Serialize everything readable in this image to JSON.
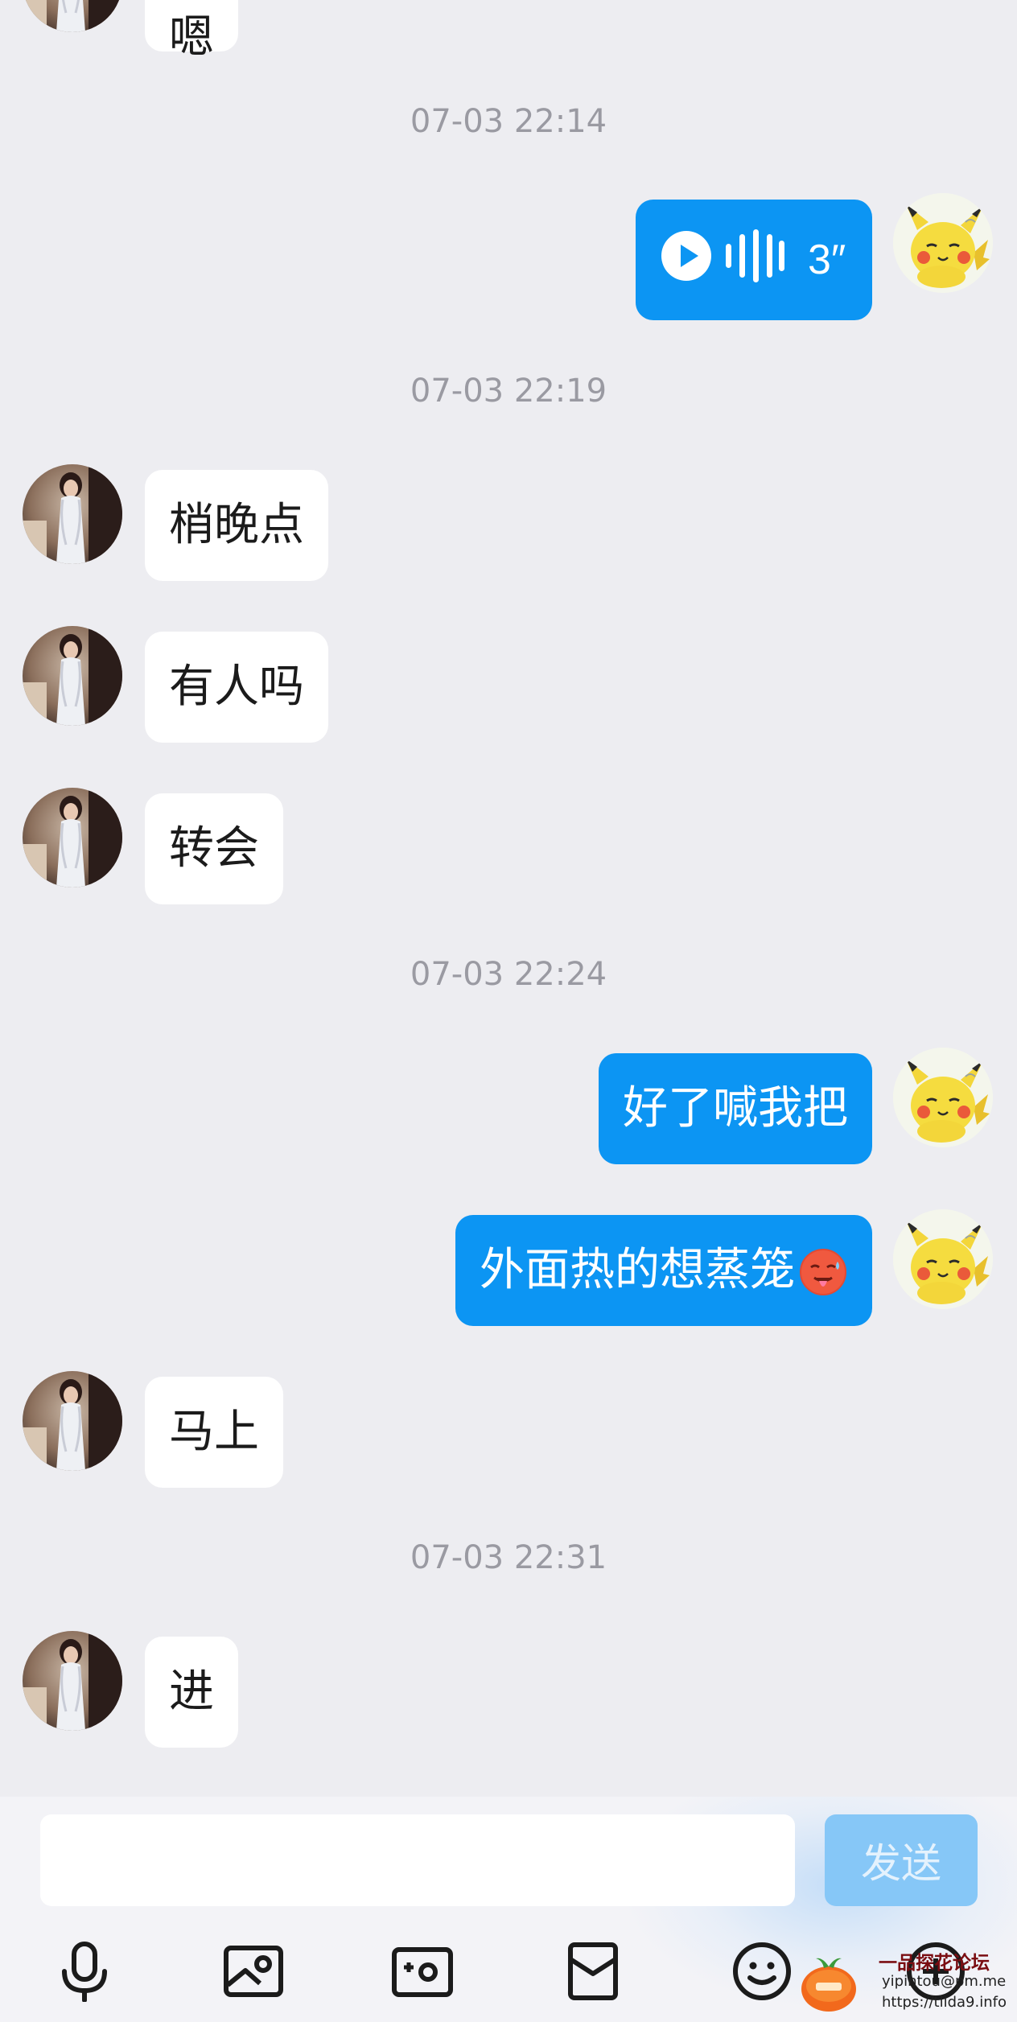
{
  "messages": [
    {
      "type": "timestamp",
      "text": "07-03 22:14"
    },
    {
      "type": "voice",
      "side": "out",
      "duration": "3″"
    },
    {
      "type": "timestamp",
      "text": "07-03 22:19"
    },
    {
      "type": "text",
      "side": "in",
      "text": "梢晚点"
    },
    {
      "type": "text",
      "side": "in",
      "text": "有人吗"
    },
    {
      "type": "text",
      "side": "in",
      "text": "转会"
    },
    {
      "type": "timestamp",
      "text": "07-03 22:24"
    },
    {
      "type": "text",
      "side": "out",
      "text": "好了喊我把"
    },
    {
      "type": "text",
      "side": "out",
      "text": "外面热的想蒸笼",
      "emoji": "hot-face-emoji"
    },
    {
      "type": "text",
      "side": "in",
      "text": "马上"
    },
    {
      "type": "timestamp",
      "text": "07-03 22:31"
    },
    {
      "type": "text",
      "side": "in",
      "text": "进"
    }
  ],
  "input": {
    "value": "",
    "placeholder": "",
    "send_label": "发送"
  },
  "toolbar": [
    "microphone-icon",
    "image-icon",
    "camera-icon",
    "red-packet-icon",
    "emoji-icon",
    "add-icon"
  ],
  "watermark": {
    "title": "一品探花论坛",
    "email": "yipintou@pm.me",
    "url": "https://tlida9.info"
  },
  "colors": {
    "accent": "#0c95f3",
    "send_disabled": "#86c7f7",
    "background": "#ededf1",
    "timestamp": "#9a9aa2"
  }
}
